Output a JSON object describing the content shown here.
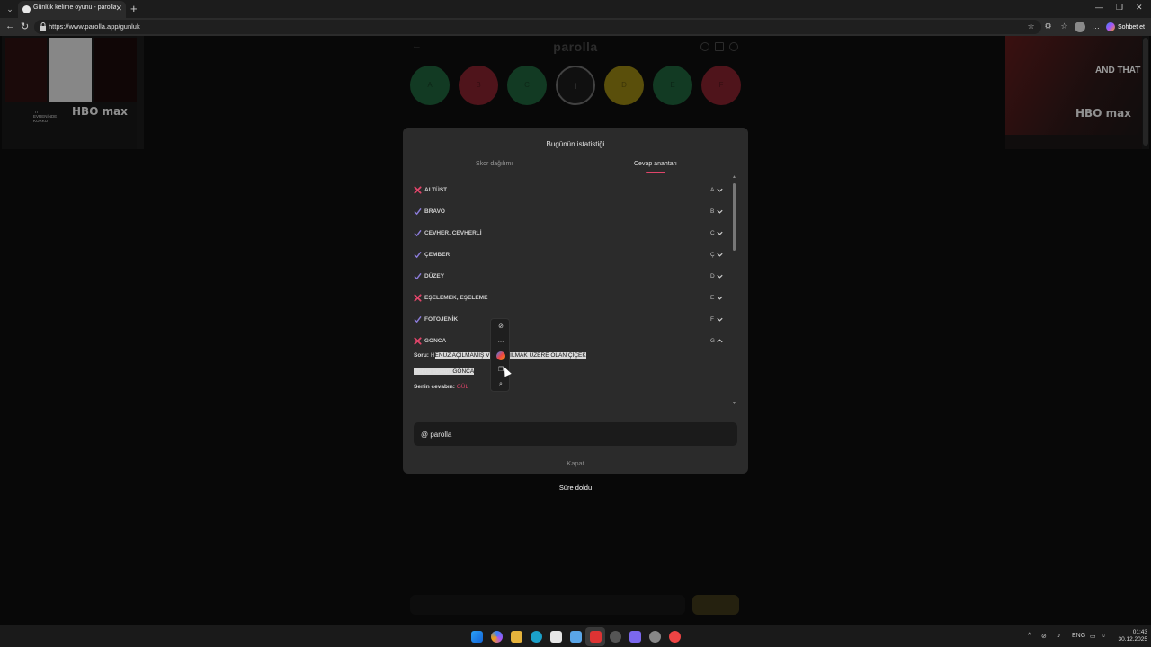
{
  "browser": {
    "tab_title": "Günlük kelime oyunu - parolla - K",
    "url": "https://www.parolla.app/gunluk",
    "copilot_label": "Sohbet et"
  },
  "ads": {
    "left_caption": "\"IT\" EVRENİNDE KORKU",
    "left_brand": "HBO max",
    "right_title": "AND THAT",
    "right_brand": "HBO max"
  },
  "app": {
    "brand": "parolla",
    "letters": [
      "A",
      "B",
      "C",
      "İ",
      "D",
      "E",
      "F"
    ]
  },
  "modal": {
    "title": "Bugünün istatistiği",
    "tabs": [
      {
        "label": "Skor dağılımı",
        "active": false
      },
      {
        "label": "Cevap anahtarı",
        "active": true
      }
    ],
    "rows": [
      {
        "answer": "ALTÜST",
        "letter": "A",
        "status": "wrong",
        "expanded": false
      },
      {
        "answer": "BRAVO",
        "letter": "B",
        "status": "correct",
        "expanded": false
      },
      {
        "answer": "CEVHER, CEVHERLİ",
        "letter": "C",
        "status": "correct",
        "expanded": false
      },
      {
        "answer": "ÇEMBER",
        "letter": "Ç",
        "status": "correct",
        "expanded": false
      },
      {
        "answer": "DÜZEY",
        "letter": "D",
        "status": "correct",
        "expanded": false
      },
      {
        "answer": "EŞELEMEK, EŞELEME",
        "letter": "E",
        "status": "wrong",
        "expanded": false
      },
      {
        "answer": "FOTOJENİK",
        "letter": "F",
        "status": "correct",
        "expanded": false
      },
      {
        "answer": "GONCA",
        "letter": "G",
        "status": "wrong",
        "expanded": true
      }
    ],
    "detail": {
      "question_label": "Soru:",
      "question_prefix": "H",
      "question_highlighted": "ENÜZ AÇILMAMIŞ VEYA AÇILMAK ÜZERE OLAN ÇİÇEK",
      "correct_label": "Doğru cevap:",
      "correct_value": "GONCA",
      "your_label": "Senin cevabın:",
      "your_value": "GÜL"
    },
    "share_text": "@ parolla",
    "close_label": "Kapat"
  },
  "status_text": "Süre doldu",
  "taskbar": {
    "language": "ENG",
    "time": "01:43",
    "date": "30.12.2025"
  },
  "colors": {
    "accent_pink": "#e0456a",
    "check_purple": "#8a7bd8",
    "modal_bg": "#2b2b2b"
  }
}
